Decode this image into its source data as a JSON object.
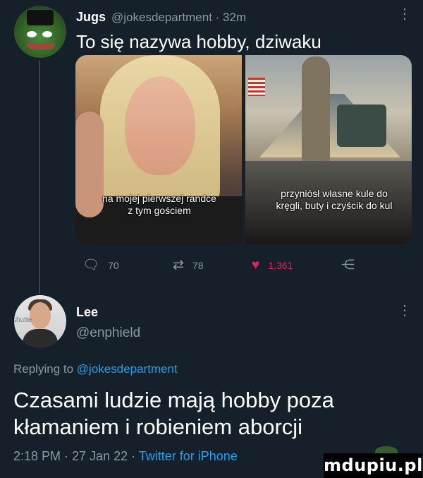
{
  "tweet": {
    "author_name": "Jugs",
    "author_handle": "@jokesdepartment · 32m",
    "text": "To się nazywa hobby, dziwaku",
    "more_icon": "more-vertical-icon",
    "media": {
      "left_caption_line1": "na mojej pierwszej randce",
      "left_caption_line2": "z tym gościem",
      "right_caption_line1": "przyniósł własne kule do",
      "right_caption_line2": "kręgli, buty i czyścik do kul"
    },
    "actions": {
      "reply_count": "70",
      "retweet_count": "78",
      "like_count": "1,361",
      "like_color": "#e0245e"
    }
  },
  "reply": {
    "author_name": "Lee",
    "author_handle": "@enphield",
    "avatar_watermark": "shutte",
    "replying_prefix": "Replying to",
    "replying_to": "@jokesdepartment",
    "text": "Czasami ludzie mają hobby poza kłamaniem i robieniem aborcji",
    "timestamp": "2:18 PM · 27 Jan 22 ·",
    "client": "Twitter for iPhone"
  },
  "watermark": {
    "text": "mdupiu.pl"
  },
  "colors": {
    "background": "#15202b",
    "muted": "#8899a6",
    "link": "#1da1f2"
  }
}
